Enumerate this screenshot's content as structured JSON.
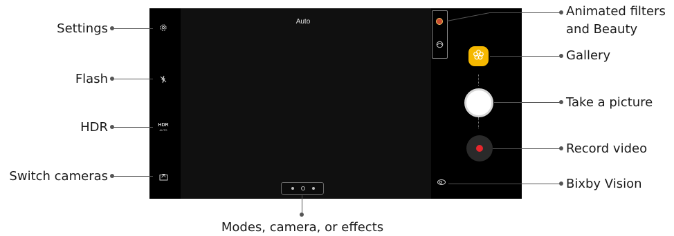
{
  "screen": {
    "mode_label": "Auto",
    "hdr_icon_text": "HDR",
    "hdr_icon_subtext": "AUTO"
  },
  "callouts": {
    "settings": "Settings",
    "flash": "Flash",
    "hdr": "HDR",
    "switch_cameras": "Switch cameras",
    "modes": "Modes, camera, or effects",
    "filters_line1": "Animated filters",
    "filters_line2": "and Beauty",
    "gallery": "Gallery",
    "take_picture": "Take a picture",
    "record_video": "Record video",
    "bixby_vision": "Bixby Vision"
  },
  "colors": {
    "gallery_accent": "#f5b800",
    "record_red": "#e8262c"
  },
  "icons": [
    "gear-icon",
    "flash-off-icon",
    "hdr-icon",
    "switch-camera-icon",
    "bear-filter-icon",
    "face-beauty-icon",
    "gallery-flower-icon",
    "bixby-eye-icon"
  ]
}
